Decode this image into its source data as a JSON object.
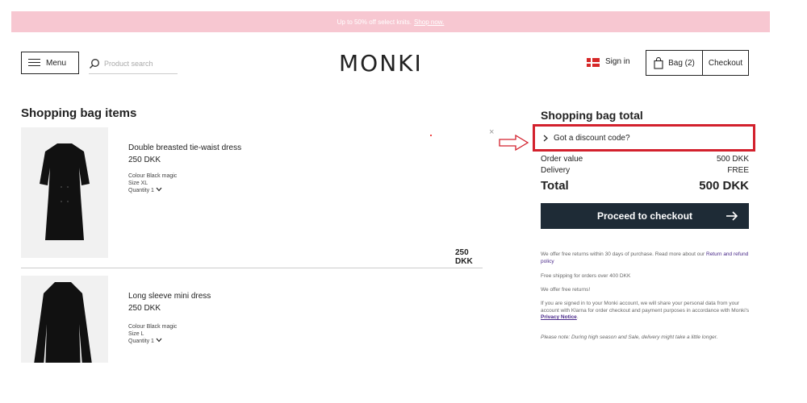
{
  "banner": {
    "text": "Up to 50% off select knits.",
    "link": "Shop now."
  },
  "header": {
    "menu_label": "Menu",
    "search_placeholder": "Product search",
    "logo": "MONKI",
    "signin": "Sign in",
    "bag": "Bag (2)",
    "checkout": "Checkout"
  },
  "items_title": "Shopping bag items",
  "items": [
    {
      "name": "Double breasted tie-waist dress",
      "price": "250 DKK",
      "colour": "Colour Black magic",
      "size": "Size XL",
      "quantity": "Quantity 1",
      "line_total": "250 DKK"
    },
    {
      "name": "Long sleeve mini dress",
      "price": "250 DKK",
      "colour": "Colour Black magic",
      "size": "Size L",
      "quantity": "Quantity 1"
    }
  ],
  "summary": {
    "title": "Shopping bag total",
    "discount": "Got a discount code?",
    "order_label": "Order value",
    "order_value": "500 DKK",
    "delivery_label": "Delivery",
    "delivery_value": "FREE",
    "total_label": "Total",
    "total_value": "500 DKK",
    "proceed": "Proceed to checkout"
  },
  "info": {
    "returns": "We offer free returns within 30 days of purchase. Read more about our",
    "returns_link": "Return and refund policy",
    "shipping": "Free shipping for orders over 400 DKK",
    "free_returns": "We offer free returns!",
    "klarna": "If you are signed in to your Monki account, we will share your personal data from your account with Klarna for order checkout and payment purposes in accordance with Monki's",
    "privacy_link": "Privacy Notice",
    "note": "Please note: During high season and Sale, delivery might take a little longer."
  },
  "colors": {
    "banner": "#f7c7d1",
    "checkout_button": "#1e2b36",
    "annotation": "#d3212d"
  }
}
